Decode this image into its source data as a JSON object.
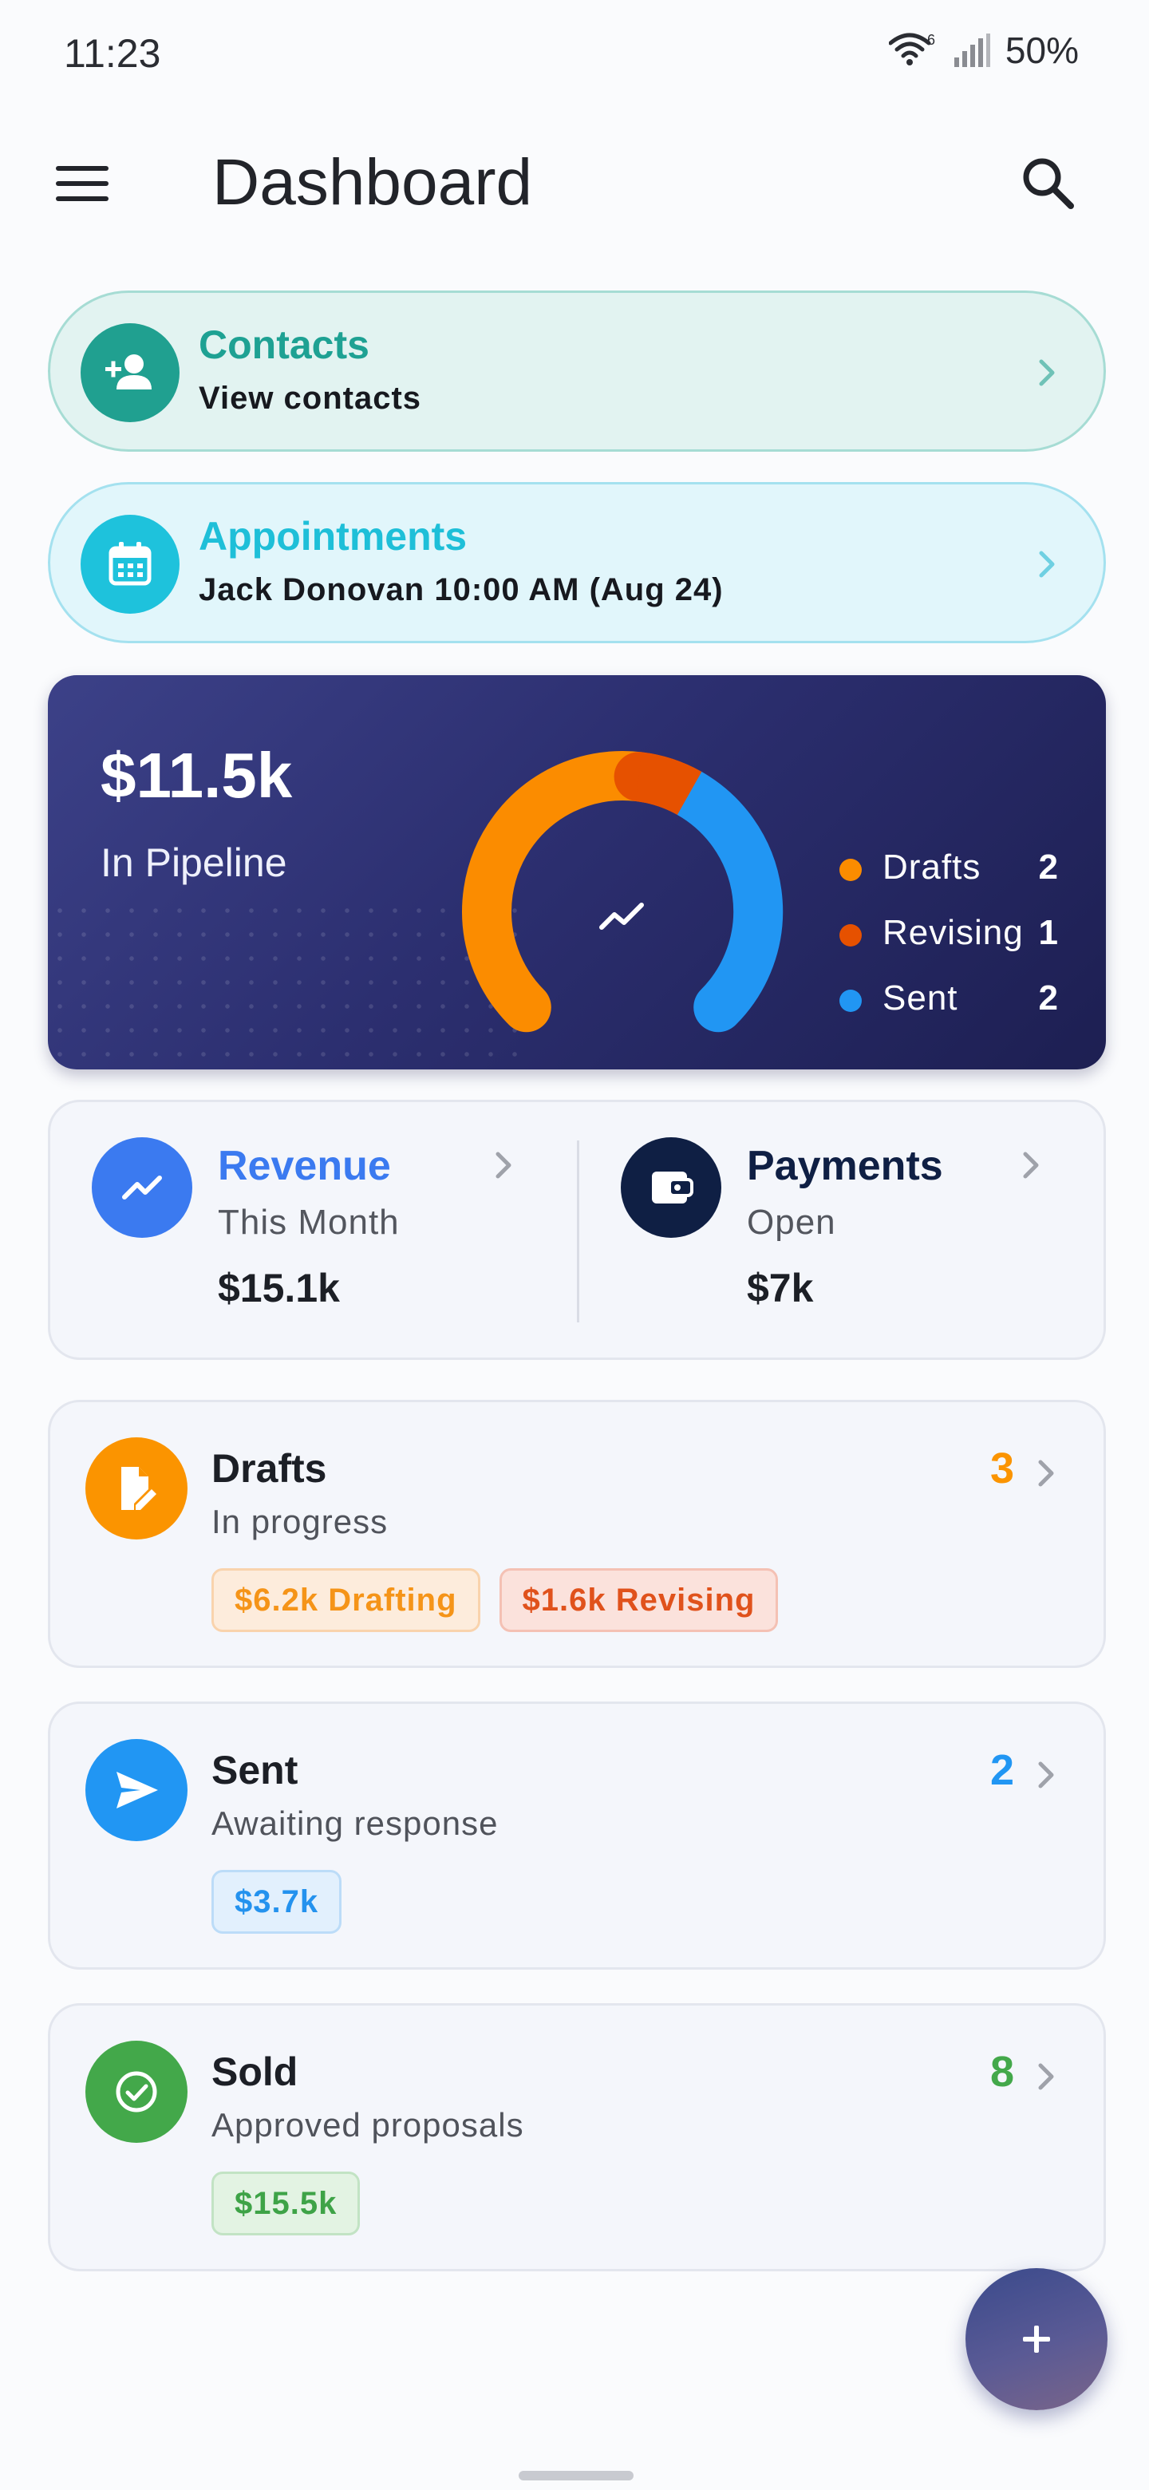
{
  "status_bar": {
    "time": "11:23",
    "wifi_label": "6",
    "battery": "50%"
  },
  "app_bar": {
    "title": "Dashboard"
  },
  "contacts": {
    "title": "Contacts",
    "subtitle": "View contacts"
  },
  "appointments": {
    "title": "Appointments",
    "subtitle": "Jack Donovan 10:00 AM (Aug 24)"
  },
  "pipeline": {
    "amount": "$11.5k",
    "label": "In Pipeline",
    "legend": [
      {
        "name": "Drafts",
        "count": "2",
        "color": "#fb8c00"
      },
      {
        "name": "Revising",
        "count": "1",
        "color": "#e65100"
      },
      {
        "name": "Sent",
        "count": "2",
        "color": "#2196f3"
      }
    ]
  },
  "revenue": {
    "title": "Revenue",
    "subtitle": "This Month",
    "value": "$15.1k",
    "color": "#3b7af0"
  },
  "payments": {
    "title": "Payments",
    "subtitle": "Open",
    "value": "$7k",
    "color": "#0f1f44"
  },
  "drafts": {
    "title": "Drafts",
    "subtitle": "In progress",
    "count": "3",
    "color": "#fb9400",
    "chips": [
      {
        "text": "$6.2k Drafting",
        "color": "#f59418",
        "bg": "#fdecdc",
        "border": "#f9d3ad"
      },
      {
        "text": "$1.6k Revising",
        "color": "#e0521c",
        "bg": "#fbe2dc",
        "border": "#f4c1b4"
      }
    ]
  },
  "sent": {
    "title": "Sent",
    "subtitle": "Awaiting response",
    "count": "2",
    "color": "#2196f3",
    "chips": [
      {
        "text": "$3.7k",
        "color": "#2492ee",
        "bg": "#e2f0fd",
        "border": "#bcdcf8"
      }
    ]
  },
  "sold": {
    "title": "Sold",
    "subtitle": "Approved proposals",
    "count": "8",
    "color": "#43a84a",
    "chips": [
      {
        "text": "$15.5k",
        "color": "#3ea347",
        "bg": "#e3f3e3",
        "border": "#c2e3c4"
      }
    ]
  },
  "fab": {
    "label": "+"
  }
}
